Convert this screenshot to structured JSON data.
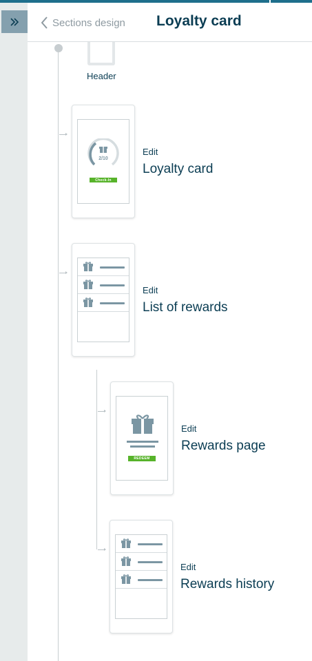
{
  "nav": {
    "back_label": "Sections design",
    "title": "Loyalty card"
  },
  "header_stub": {
    "label": "Header"
  },
  "sections": [
    {
      "edit": "Edit",
      "name": "Loyalty card",
      "progress": "2/10",
      "button": "Check-In"
    },
    {
      "edit": "Edit",
      "name": "List of rewards"
    },
    {
      "edit": "Edit",
      "name": "Rewards page",
      "button": "REDEEM"
    },
    {
      "edit": "Edit",
      "name": "Rewards history"
    }
  ],
  "colors": {
    "accent": "#1e6f8c",
    "title": "#0b3d53",
    "rail": "#e7ebeb",
    "rail_button": "#84a0ae",
    "icon_slate": "#7b96a3",
    "green": "#57b32a"
  },
  "icons": {
    "expand": "double-chevron-right-icon",
    "back": "chevron-left-icon",
    "gift": "gift-icon"
  }
}
